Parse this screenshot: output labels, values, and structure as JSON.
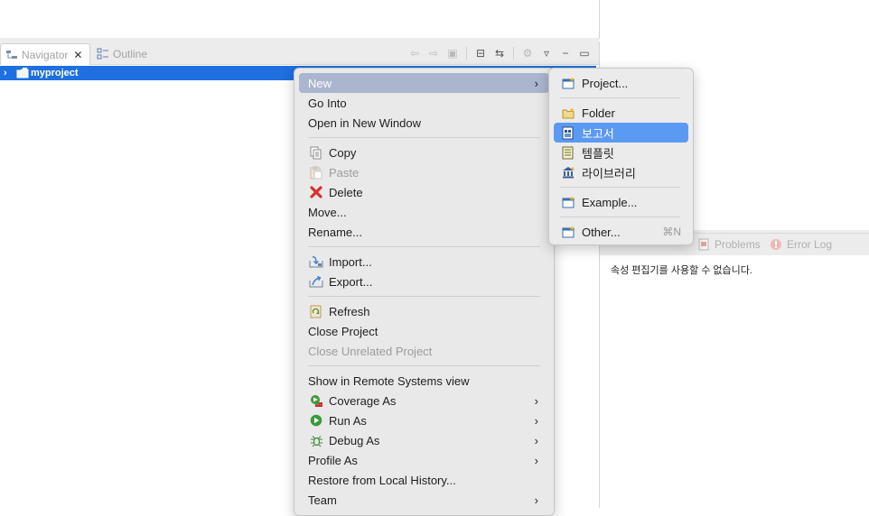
{
  "navigator_panel": {
    "tabs": [
      {
        "label": "Navigator",
        "icon": "navigator-icon",
        "active": true
      },
      {
        "label": "Outline",
        "icon": "outline-icon",
        "active": false
      }
    ],
    "toolbar_icons": [
      "back-icon",
      "forward-icon",
      "up-icon",
      "collapse-all-icon",
      "link-editor-icon",
      "filter-icon",
      "view-menu-icon",
      "minimize-icon",
      "maximize-icon"
    ],
    "tree": {
      "label": "myproject",
      "expanded": false,
      "selected": true
    }
  },
  "properties_panel": {
    "tabs": [
      {
        "label": "Problems",
        "icon": "problems-icon"
      },
      {
        "label": "Error Log",
        "icon": "error-log-icon"
      }
    ],
    "message": "속성 편집기를 사용할 수 없습니다."
  },
  "context_menu": {
    "items": [
      {
        "label": "New",
        "submenu": true,
        "highlighted": true
      },
      {
        "label": "Go Into"
      },
      {
        "label": "Open in New Window"
      },
      {
        "label": "Copy",
        "icon": "copy-icon"
      },
      {
        "label": "Paste",
        "icon": "paste-icon",
        "disabled": true
      },
      {
        "label": "Delete",
        "icon": "delete-icon"
      },
      {
        "label": "Move..."
      },
      {
        "label": "Rename..."
      },
      {
        "label": "Import...",
        "icon": "import-icon"
      },
      {
        "label": "Export...",
        "icon": "export-icon"
      },
      {
        "label": "Refresh",
        "icon": "refresh-icon"
      },
      {
        "label": "Close Project"
      },
      {
        "label": "Close Unrelated Project",
        "disabled": true
      },
      {
        "label": "Show in Remote Systems view"
      },
      {
        "label": "Coverage As",
        "icon": "coverage-icon",
        "submenu": true
      },
      {
        "label": "Run As",
        "icon": "run-icon",
        "submenu": true
      },
      {
        "label": "Debug As",
        "icon": "debug-icon",
        "submenu": true
      },
      {
        "label": "Profile As",
        "submenu": true
      },
      {
        "label": "Restore from Local History..."
      },
      {
        "label": "Team",
        "submenu": true
      }
    ],
    "chevron": "›"
  },
  "new_submenu": {
    "items": [
      {
        "label": "Project...",
        "icon": "new-project-icon"
      },
      {
        "label": "Folder",
        "icon": "folder-icon"
      },
      {
        "label": "보고서",
        "icon": "report-icon",
        "highlighted": true
      },
      {
        "label": "템플릿",
        "icon": "template-icon"
      },
      {
        "label": "라이브러리",
        "icon": "library-icon"
      },
      {
        "label": "Example...",
        "icon": "example-icon"
      },
      {
        "label": "Other...",
        "icon": "other-icon",
        "shortcut": "⌘N"
      }
    ]
  },
  "colors": {
    "selection_blue": "#1e6fe0",
    "submenu_highlight": "#5b9af2",
    "menu_highlight": "#a9b6cd",
    "menu_bg": "#e9e9e9"
  }
}
